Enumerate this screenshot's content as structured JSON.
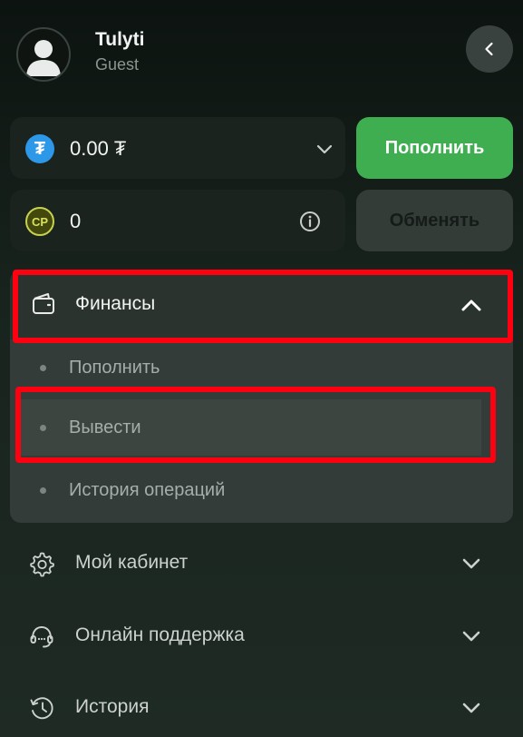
{
  "user": {
    "name": "Tulyti",
    "role": "Guest"
  },
  "balance": {
    "amount": "0.00 ₮",
    "currency_icon": "usdt-icon",
    "currency_symbol": "₮"
  },
  "points": {
    "amount": "0",
    "badge": "CP"
  },
  "buttons": {
    "topup": "Пополнить",
    "exchange": "Обменять"
  },
  "finance": {
    "label": "Финансы",
    "expanded": true,
    "items": [
      {
        "label": "Пополнить"
      },
      {
        "label": "Вывести"
      },
      {
        "label": "История операций"
      }
    ]
  },
  "menu": [
    {
      "label": "Мой кабинет",
      "icon": "gear-icon"
    },
    {
      "label": "Онлайн поддержка",
      "icon": "headset-icon"
    },
    {
      "label": "История",
      "icon": "history-icon"
    }
  ],
  "colors": {
    "accent_green": "#3fae50",
    "usdt_blue": "#2d98e8",
    "highlight_red": "#ff0010"
  }
}
